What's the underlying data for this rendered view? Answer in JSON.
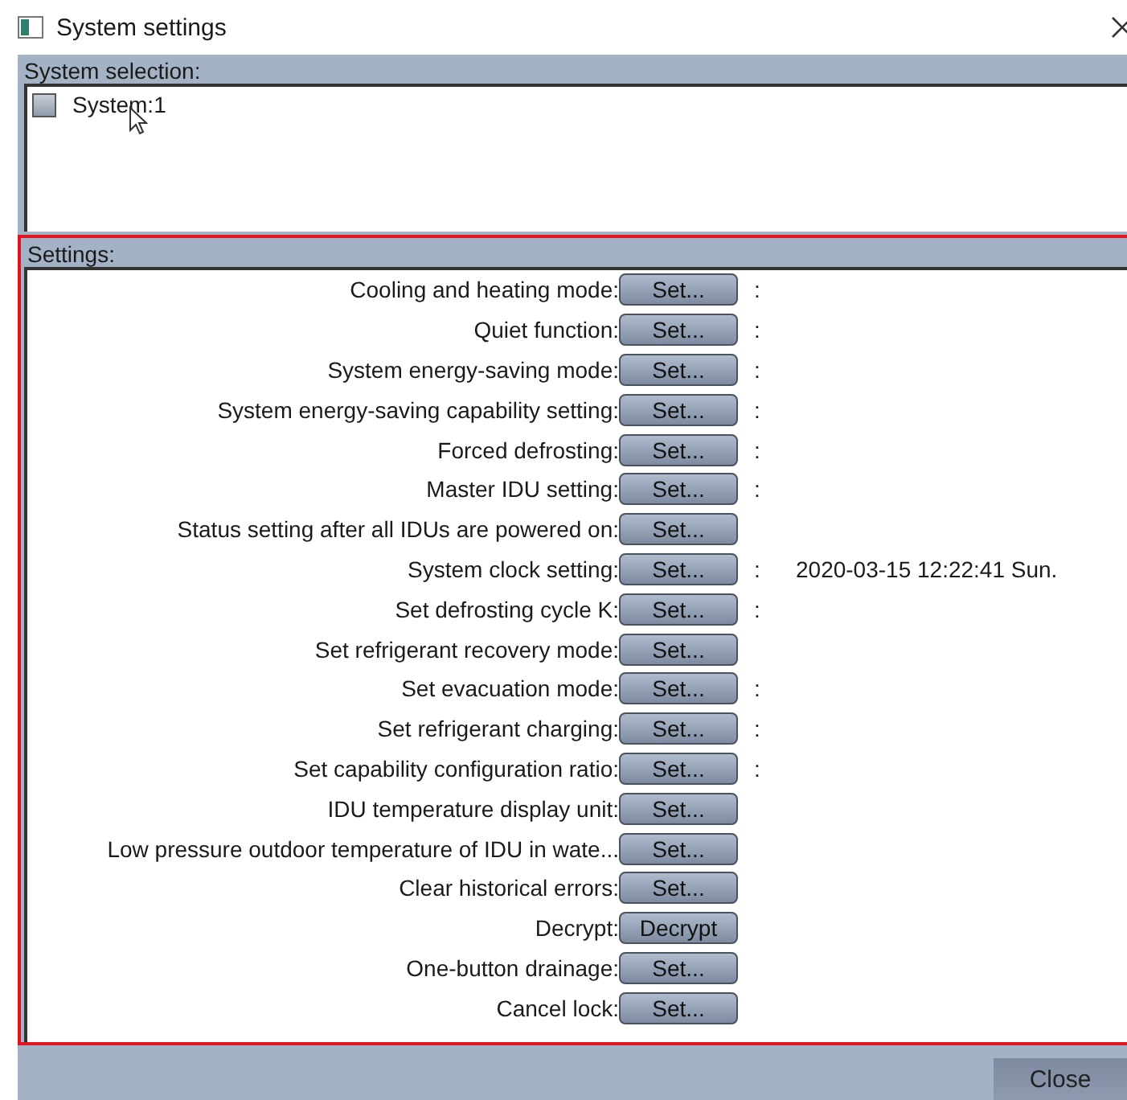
{
  "window": {
    "title": "System settings"
  },
  "system_selection": {
    "label": "System selection:",
    "items": [
      {
        "label": "System:1",
        "checked": false
      }
    ]
  },
  "settings": {
    "label": "Settings:",
    "rows": [
      {
        "label": "Cooling and heating mode:",
        "button": "Set...",
        "separator": ":"
      },
      {
        "label": "Quiet function:",
        "button": "Set...",
        "separator": ":"
      },
      {
        "label": "System energy-saving mode:",
        "button": "Set...",
        "separator": ":"
      },
      {
        "label": "System energy-saving capability setting:",
        "button": "Set...",
        "separator": ":"
      },
      {
        "label": "Forced defrosting:",
        "button": "Set...",
        "separator": ":"
      },
      {
        "label": "Master IDU setting:",
        "button": "Set...",
        "separator": ":"
      },
      {
        "label": "Status setting after all IDUs are powered on:",
        "button": "Set..."
      },
      {
        "label": "System clock setting:",
        "button": "Set...",
        "separator": ":",
        "value": "2020-03-15 12:22:41 Sun."
      },
      {
        "label": "Set defrosting cycle K:",
        "button": "Set...",
        "separator": ":"
      },
      {
        "label": "Set refrigerant recovery mode:",
        "button": "Set..."
      },
      {
        "label": "Set evacuation mode:",
        "button": "Set...",
        "separator": ":"
      },
      {
        "label": "Set refrigerant charging:",
        "button": "Set...",
        "separator": ":"
      },
      {
        "label": "Set capability configuration ratio:",
        "button": "Set...",
        "separator": ":"
      },
      {
        "label": "IDU temperature display unit:",
        "button": "Set..."
      },
      {
        "label": "Low pressure outdoor temperature of IDU in wate...",
        "button": "Set..."
      },
      {
        "label": "Clear historical errors:",
        "button": "Set..."
      },
      {
        "label": "Decrypt:",
        "button": "Decrypt"
      },
      {
        "label": "One-button drainage:",
        "button": "Set..."
      },
      {
        "label": "Cancel lock:",
        "button": "Set..."
      }
    ]
  },
  "buttons": [
    "Close"
  ]
}
